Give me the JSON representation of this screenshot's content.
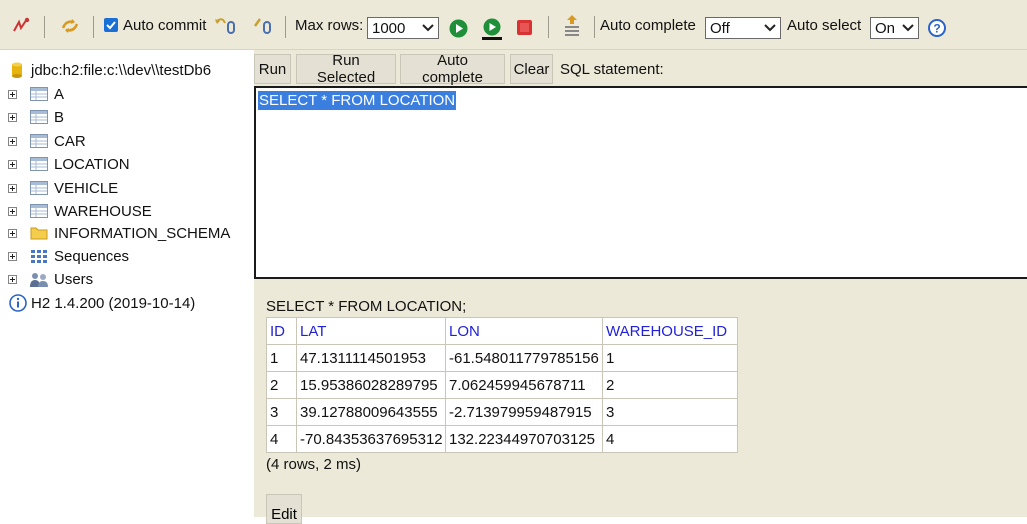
{
  "toolbar": {
    "auto_commit_label": "Auto commit",
    "max_rows_label": "Max rows:",
    "max_rows_value": "1000",
    "auto_complete_label": "Auto complete",
    "auto_complete_value": "Off",
    "auto_select_label": "Auto select",
    "auto_select_value": "On",
    "help_icon": "help-icon",
    "colors": {
      "run_green": "#1f8f3a",
      "stop_red": "#d83232",
      "checkbox_blue": "#1a6fd6"
    }
  },
  "tree": {
    "connection": "jdbc:h2:file:c:\\\\dev\\\\testDb6",
    "items": [
      {
        "label": "A",
        "icon": "table-icon"
      },
      {
        "label": "B",
        "icon": "table-icon"
      },
      {
        "label": "CAR",
        "icon": "table-icon"
      },
      {
        "label": "LOCATION",
        "icon": "table-icon"
      },
      {
        "label": "VEHICLE",
        "icon": "table-icon"
      },
      {
        "label": "WAREHOUSE",
        "icon": "table-icon"
      },
      {
        "label": "INFORMATION_SCHEMA",
        "icon": "folder-icon"
      },
      {
        "label": "Sequences",
        "icon": "sequence-icon"
      },
      {
        "label": "Users",
        "icon": "users-icon"
      }
    ],
    "version": "H2 1.4.200 (2019-10-14)"
  },
  "editor": {
    "buttons": {
      "run": "Run",
      "run_selected": "Run Selected",
      "auto_complete": "Auto complete",
      "clear": "Clear"
    },
    "sql_label": "SQL statement:",
    "sql_text": "SELECT * FROM LOCATION"
  },
  "result": {
    "statement": "SELECT * FROM LOCATION;",
    "columns": [
      "ID",
      "LAT",
      "LON",
      "WAREHOUSE_ID"
    ],
    "rows": [
      [
        "1",
        "47.1311114501953",
        "-61.548011779785156",
        "1"
      ],
      [
        "2",
        "15.95386028289795",
        "7.062459945678711",
        "2"
      ],
      [
        "3",
        "39.12788009643555",
        "-2.713979959487915",
        "3"
      ],
      [
        "4",
        "-70.84353637695312",
        "132.22344970703125",
        "4"
      ]
    ],
    "info": "(4 rows, 2 ms)",
    "edit_label": "Edit"
  }
}
